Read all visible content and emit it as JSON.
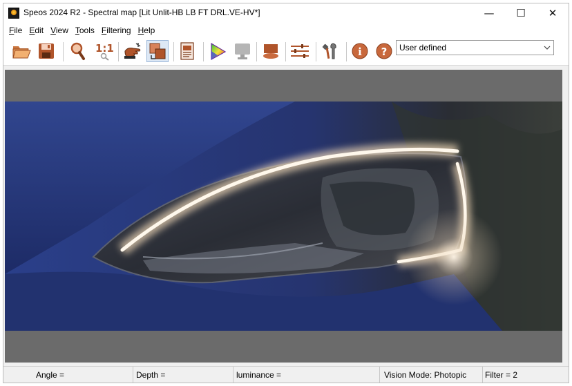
{
  "window": {
    "title": "Speos 2024 R2 - Spectral map [Lit Unlit-HB LB FT DRL.VE-HV*]",
    "controls": {
      "minimize": "—",
      "maximize": "☐",
      "close": "✕"
    }
  },
  "menu": {
    "file": {
      "accel": "F",
      "rest": "ile"
    },
    "edit": {
      "accel": "E",
      "rest": "dit"
    },
    "view": {
      "accel": "V",
      "rest": "iew"
    },
    "tools": {
      "accel": "T",
      "rest": "ools"
    },
    "filtering": {
      "accel": "F",
      "rest": "iltering"
    },
    "help": {
      "accel": "H",
      "rest": "elp"
    }
  },
  "toolbar": {
    "icons": [
      "open-folder-icon",
      "save-icon",
      "zoom-icon",
      "actual-size-icon",
      "hand-pointer-icon",
      "layers-icon",
      "document-icon",
      "color-triangle-icon",
      "monitor-icon",
      "surface-icon",
      "sliders-icon",
      "tools-icon",
      "info-icon",
      "help-icon"
    ],
    "actual_size_label": "1:1",
    "mode_dropdown": {
      "value": "User defined"
    }
  },
  "colors": {
    "accent_copper": "#b0542a",
    "viewport_gray": "#6b6b6b",
    "car_blue": "#1f2d6e"
  },
  "status": {
    "angle": "Angle =",
    "depth": "Depth =",
    "luminance": "luminance =",
    "vision_mode": "Vision Mode: Photopic",
    "filter": "Filter = 2"
  }
}
